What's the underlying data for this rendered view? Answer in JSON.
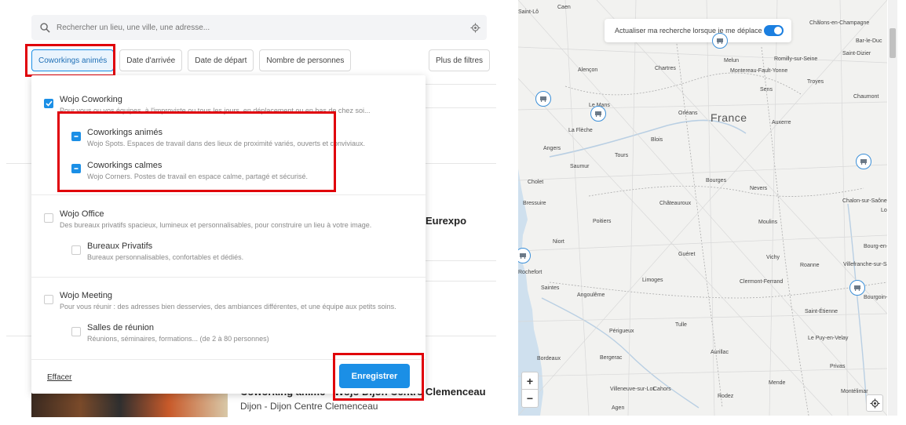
{
  "search": {
    "placeholder": "Rechercher un lieu, une ville, une adresse..."
  },
  "filters": {
    "coworkings": "Coworkings animés",
    "arrival": "Date d'arrivée",
    "departure": "Date de départ",
    "people": "Nombre de personnes",
    "more": "Plus de filtres"
  },
  "dropdown": {
    "coworking": {
      "label": "Wojo Coworking",
      "desc": "Pour vous ou vos équipes, à l'improviste ou tous les jours, en déplacement ou en bas de chez soi...",
      "state": "checked",
      "children": [
        {
          "label": "Coworkings animés",
          "desc": "Wojo Spots. Espaces de travail dans des lieux de proximité variés, ouverts et conviviaux.",
          "state": "mixed"
        },
        {
          "label": "Coworkings calmes",
          "desc": "Wojo Corners. Postes de travail en espace calme, partagé et sécurisé.",
          "state": "mixed"
        }
      ]
    },
    "office": {
      "label": "Wojo Office",
      "desc": "Des bureaux privatifs spacieux, lumineux et personnalisables, pour construire un lieu à votre image.",
      "state": "unchecked",
      "children": [
        {
          "label": "Bureaux Privatifs",
          "desc": "Bureaux personnalisables, confortables et dédiés.",
          "state": "unchecked"
        }
      ]
    },
    "meeting": {
      "label": "Wojo Meeting",
      "desc": "Pour vous réunir : des adresses bien desservies, des ambiances différentes, et une équipe aux petits soins.",
      "state": "unchecked",
      "children": [
        {
          "label": "Salles de réunion",
          "desc": "Réunions, séminaires, formations... (de 2 à 80 personnes)",
          "state": "unchecked"
        }
      ]
    },
    "clear": "Effacer",
    "save": "Enregistrer"
  },
  "listing": {
    "partial_title_1": "Eurexpo",
    "partial_title_2": "Coworking animé - Wojo Dijon Centre Clemenceau",
    "subtitle": "Dijon - Dijon Centre Clemenceau"
  },
  "map": {
    "toggle_label": "Actualiser ma recherche lorsque je me déplace",
    "toggle_on": true,
    "country": "France",
    "zoom_in": "+",
    "zoom_out": "−",
    "labels": [
      "Saint-Lô",
      "Caen",
      "Châlons-en-Champagne",
      "Saint-Dizier",
      "Bar-le-Duc",
      "Alençon",
      "Chartres",
      "Melun",
      "Romilly-sur-Seine",
      "Montereau-Fault-Yonne",
      "Troyes",
      "Sens",
      "Le Mans",
      "Chaumont",
      "Orléans",
      "Auxerre",
      "La Flèche",
      "Blois",
      "Angers",
      "Saumur",
      "Tours",
      "Cholet",
      "Bourges",
      "Nevers",
      "Bressuire",
      "Châteauroux",
      "Chalon-sur-Saône",
      "Lons-le-Saunier",
      "Poitiers",
      "Moulins",
      "Niort",
      "Guéret",
      "Vichy",
      "Bourg-en-Bresse",
      "Rochefort",
      "Limoges",
      "Clermont-Ferrand",
      "Roanne",
      "Villefranche-sur-Saône",
      "Saintes",
      "Angoulême",
      "Bourgoin-Jallieu",
      "Tulle",
      "Saint-Étienne",
      "Périgueux",
      "Le Puy-en-Velay",
      "Bergerac",
      "Aurillac",
      "Bordeaux",
      "Privas",
      "Cahors",
      "Mende",
      "Villeneuve-sur-Lot",
      "Rodez",
      "Agen",
      "Montélimar"
    ]
  },
  "colors": {
    "accent": "#1b8fe6",
    "highlight": "#e0000a"
  }
}
